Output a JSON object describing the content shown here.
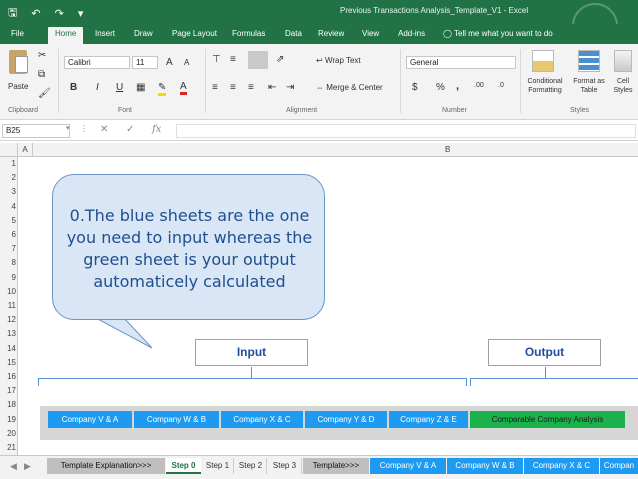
{
  "titlebar": {
    "title": "Previous Transactions Analysis_Template_V1 - Excel",
    "qat_icons": [
      "save-icon",
      "undo-icon",
      "redo-icon",
      "customize-icon"
    ]
  },
  "tabs": [
    {
      "label": "File"
    },
    {
      "label": "Home"
    },
    {
      "label": "Insert"
    },
    {
      "label": "Draw"
    },
    {
      "label": "Page Layout"
    },
    {
      "label": "Formulas"
    },
    {
      "label": "Data"
    },
    {
      "label": "Review"
    },
    {
      "label": "View"
    },
    {
      "label": "Add-ins"
    }
  ],
  "tell_me": "Tell me what you want to do",
  "ribbon": {
    "paste_label": "Paste",
    "font_name": "Calibri",
    "font_size": "11",
    "bold": "B",
    "italic": "I",
    "underline": "U",
    "grow_font": "A",
    "shrink_font": "A",
    "wrap_text": "Wrap Text",
    "merge_center": "Merge & Center",
    "number_format": "General",
    "currency": "$",
    "percent": "%",
    "comma": ",",
    "inc_decimal": ".00",
    "dec_decimal": ".0",
    "conditional_formatting": "Conditional Formatting",
    "format_as_table": "Format as Table",
    "cell_styles": "Cell Styles",
    "groups": {
      "clipboard": "Clipboard",
      "font": "Font",
      "alignment": "Alignment",
      "number": "Number",
      "styles": "Styles"
    }
  },
  "formula_bar": {
    "name_box": "B25",
    "cancel": "✕",
    "enter": "✓",
    "fx": "fx",
    "value": ""
  },
  "grid": {
    "col_a": "A",
    "col_b": "B",
    "rows": [
      "1",
      "2",
      "3",
      "4",
      "5",
      "6",
      "7",
      "8",
      "9",
      "10",
      "11",
      "12",
      "13",
      "14",
      "15",
      "16",
      "17",
      "18",
      "19",
      "20",
      "21"
    ]
  },
  "callout": {
    "text": "0.The blue sheets are the one you need to input whereas the green sheet is your output automaticely calculated"
  },
  "labels": {
    "input": "Input",
    "output": "Output"
  },
  "sheet_buttons": [
    {
      "label": "Company V & A",
      "color": "#1e9bf0"
    },
    {
      "label": "Company W & B",
      "color": "#1e9bf0"
    },
    {
      "label": "Company X & C",
      "color": "#1e9bf0"
    },
    {
      "label": "Company Y & D",
      "color": "#1e9bf0"
    },
    {
      "label": "Company Z & E",
      "color": "#1e9bf0"
    },
    {
      "label": "Comparable Company Analysis",
      "color": "#1cb24b"
    }
  ],
  "sheet_tabs": [
    {
      "label": "Template Explanation>>>",
      "style": "grey"
    },
    {
      "label": "Step 0",
      "style": "active"
    },
    {
      "label": "Step 1",
      "style": "plain"
    },
    {
      "label": "Step 2",
      "style": "plain"
    },
    {
      "label": "Step 3",
      "style": "plain"
    },
    {
      "label": "Template>>>",
      "style": "grey"
    },
    {
      "label": "Company V & A",
      "style": "blue"
    },
    {
      "label": "Company W & B",
      "style": "blue"
    },
    {
      "label": "Company X & C",
      "style": "blue"
    },
    {
      "label": "Compan",
      "style": "blue"
    }
  ],
  "colors": {
    "excel_green": "#217346",
    "input_blue": "#1e9bf0",
    "output_green": "#1cb24b",
    "callout_fill": "#d9e6f5",
    "callout_text": "#1f4f8f"
  }
}
